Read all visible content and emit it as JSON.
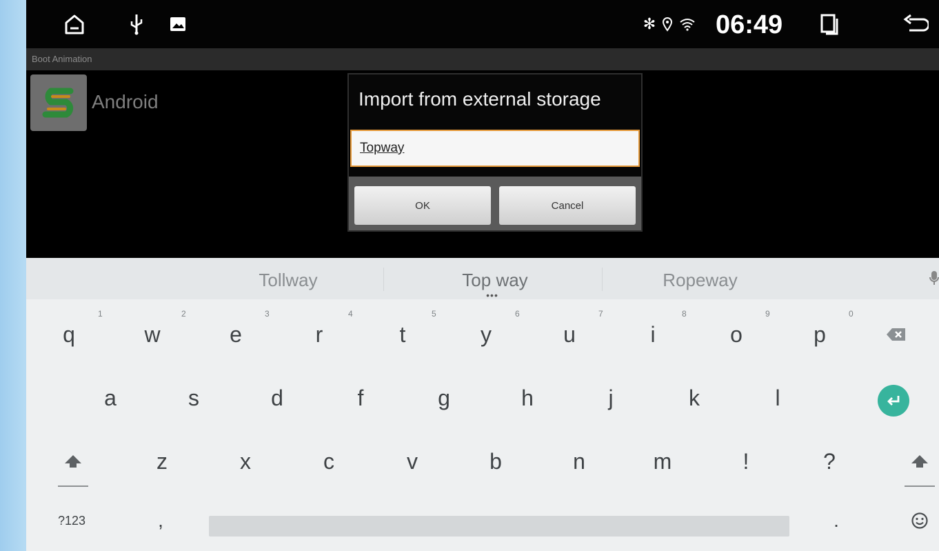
{
  "status_bar": {
    "time": "06:49",
    "icons": [
      "home-icon",
      "usb-icon",
      "image-icon",
      "bluetooth-icon",
      "location-icon",
      "wifi-icon",
      "recents-icon",
      "back-icon"
    ]
  },
  "app": {
    "title": "Boot Animation",
    "item_label": "Android"
  },
  "dialog": {
    "title": "Import from external storage",
    "input_value": "Topway",
    "ok_label": "OK",
    "cancel_label": "Cancel"
  },
  "keyboard": {
    "suggestions": [
      "Tollway",
      "Top way",
      "Ropeway"
    ],
    "row1": [
      {
        "key": "q",
        "hint": "1"
      },
      {
        "key": "w",
        "hint": "2"
      },
      {
        "key": "e",
        "hint": "3"
      },
      {
        "key": "r",
        "hint": "4"
      },
      {
        "key": "t",
        "hint": "5"
      },
      {
        "key": "y",
        "hint": "6"
      },
      {
        "key": "u",
        "hint": "7"
      },
      {
        "key": "i",
        "hint": "8"
      },
      {
        "key": "o",
        "hint": "9"
      },
      {
        "key": "p",
        "hint": "0"
      }
    ],
    "row2": [
      "a",
      "s",
      "d",
      "f",
      "g",
      "h",
      "j",
      "k",
      "l"
    ],
    "row3": [
      "z",
      "x",
      "c",
      "v",
      "b",
      "n",
      "m",
      "!",
      "?"
    ],
    "symbols_label": "?123",
    "comma_label": ",",
    "period_label": ".",
    "accent_color": "#37b49d"
  }
}
